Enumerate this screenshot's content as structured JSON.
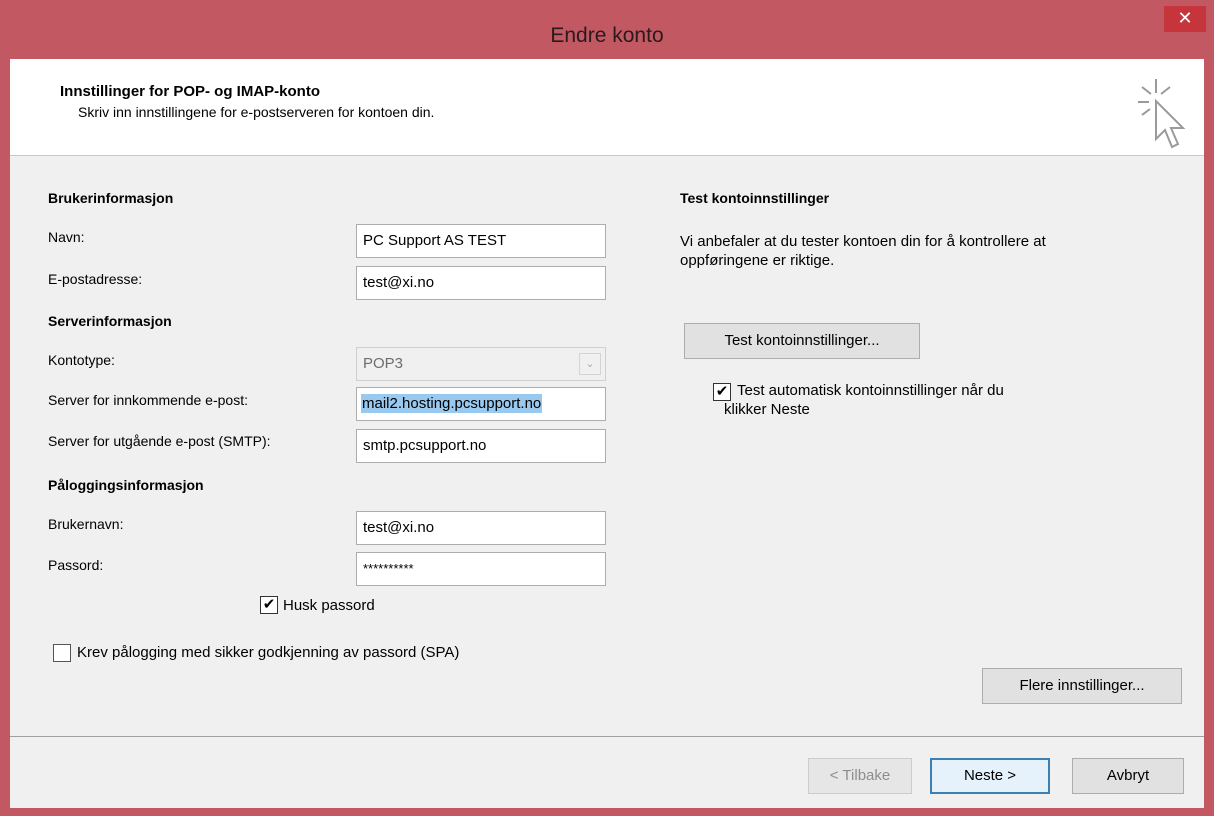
{
  "window": {
    "title": "Endre konto",
    "close_symbol": "✕",
    "accent_color": "#c15862"
  },
  "header": {
    "title": "Innstillinger for POP- og IMAP-konto",
    "subtitle": "Skriv inn innstillingene for e-postserveren for kontoen din.",
    "icon": "cursor-click-icon"
  },
  "user_info": {
    "section": "Brukerinformasjon",
    "name_label": "Navn:",
    "name_value": "PC Support AS TEST",
    "email_label": "E-postadresse:",
    "email_value": "test@xi.no"
  },
  "server_info": {
    "section": "Serverinformasjon",
    "account_type_label": "Kontotype:",
    "account_type_value": "POP3",
    "incoming_label": "Server for innkommende e-post:",
    "incoming_value": "mail2.hosting.pcsupport.no",
    "outgoing_label": "Server for utgående e-post (SMTP):",
    "outgoing_value": "smtp.pcsupport.no"
  },
  "login_info": {
    "section": "Påloggingsinformasjon",
    "username_label": "Brukernavn:",
    "username_value": "test@xi.no",
    "password_label": "Passord:",
    "password_value": "**********",
    "remember_label": "Husk passord",
    "remember_checked": true,
    "spa_label": "Krev pålogging med sikker godkjenning av passord (SPA)",
    "spa_checked": false
  },
  "test": {
    "section": "Test kontoinnstillinger",
    "description_line1": "Vi anbefaler at du tester kontoen din for å kontrollere at",
    "description_line2": "oppføringene er riktige.",
    "button": "Test kontoinnstillinger...",
    "auto_label_line1": "Test automatisk kontoinnstillinger når du",
    "auto_label_line2": "klikker Neste",
    "auto_checked": true
  },
  "more_settings_button": "Flere innstillinger...",
  "footer": {
    "back": "< Tilbake",
    "next": "Neste >",
    "cancel": "Avbryt"
  },
  "check_mark": "✔"
}
